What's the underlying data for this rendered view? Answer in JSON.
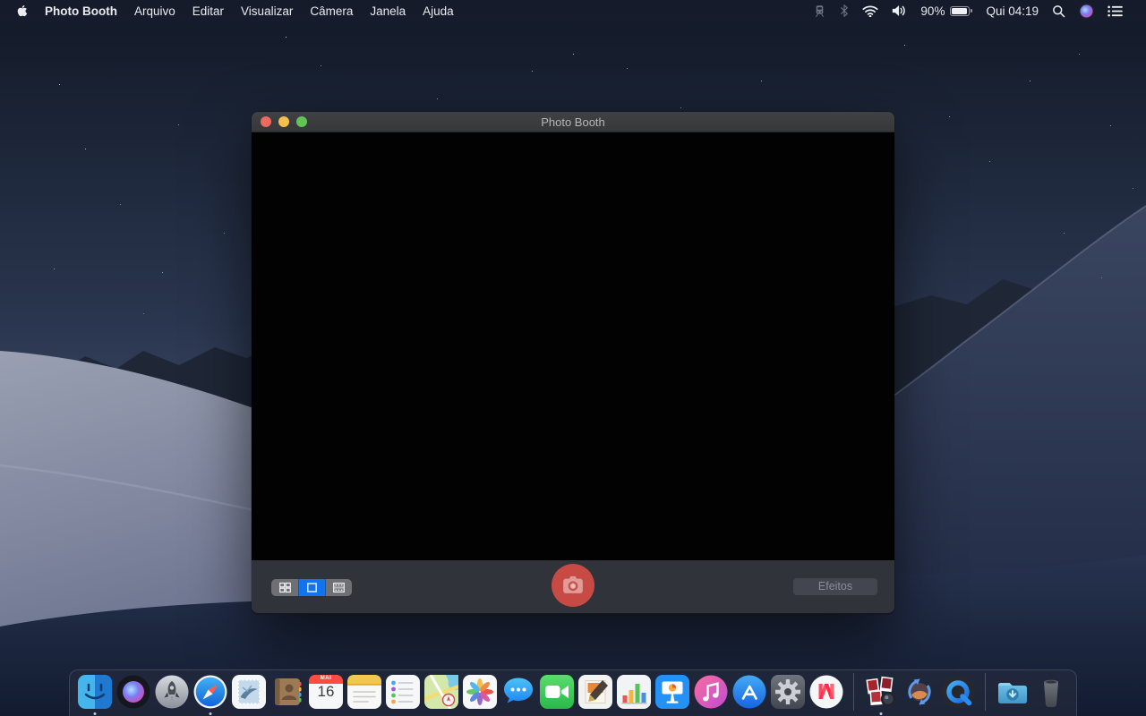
{
  "menu_bar": {
    "app_name": "Photo Booth",
    "items": [
      "Arquivo",
      "Editar",
      "Visualizar",
      "Câmera",
      "Janela",
      "Ajuda"
    ],
    "status": {
      "battery_percent": "90%",
      "clock": "Qui 04:19"
    }
  },
  "window": {
    "title": "Photo Booth",
    "toolbar": {
      "effects_label": "Efeitos",
      "view_modes": [
        "grid",
        "single",
        "filmstrip"
      ],
      "selected_view": "single"
    }
  },
  "dock": {
    "calendar": {
      "month": "MAI",
      "day": "16"
    },
    "items": [
      {
        "name": "finder",
        "running": true
      },
      {
        "name": "siri",
        "running": false
      },
      {
        "name": "launchpad",
        "running": false
      },
      {
        "name": "safari",
        "running": true
      },
      {
        "name": "mail",
        "running": false
      },
      {
        "name": "contacts",
        "running": false
      },
      {
        "name": "calendar",
        "running": false
      },
      {
        "name": "notes",
        "running": false
      },
      {
        "name": "reminders",
        "running": false
      },
      {
        "name": "maps",
        "running": false
      },
      {
        "name": "photos",
        "running": false
      },
      {
        "name": "messages",
        "running": false
      },
      {
        "name": "facetime",
        "running": false
      },
      {
        "name": "pages",
        "running": false
      },
      {
        "name": "numbers",
        "running": false
      },
      {
        "name": "keynote",
        "running": false
      },
      {
        "name": "itunes",
        "running": false
      },
      {
        "name": "app-store",
        "running": false
      },
      {
        "name": "system-preferences",
        "running": false
      },
      {
        "name": "news",
        "running": false
      },
      {
        "name": "photo-booth",
        "running": true
      },
      {
        "name": "software-update",
        "running": false
      },
      {
        "name": "quicktime",
        "running": false
      },
      {
        "name": "downloads",
        "running": false
      },
      {
        "name": "trash",
        "running": false
      }
    ]
  },
  "colors": {
    "accent_blue": "#1373ec",
    "shutter_red": "#c74b44",
    "traffic_close": "#ed6a5e",
    "traffic_min": "#f4bf4f",
    "traffic_zoom": "#61c555"
  }
}
